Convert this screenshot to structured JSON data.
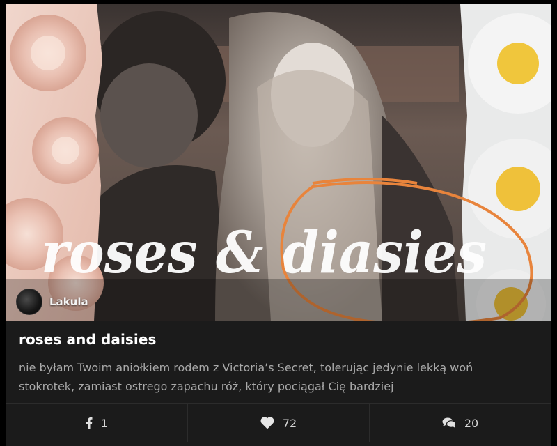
{
  "cover": {
    "overlay_text": "roses & diasies"
  },
  "author": {
    "name": "Lakula"
  },
  "story": {
    "title": "roses and daisies",
    "description": "nie byłam Twoim aniołkiem rodem z Victoria’s Secret, tolerując jedynie lekką woń stokrotek, zamiast ostrego zapachu róż, który pociągał Cię bardziej"
  },
  "stats": {
    "facebook_shares": "1",
    "likes": "72",
    "comments": "20"
  },
  "icons": {
    "facebook": "facebook-icon",
    "like": "heart-icon",
    "comment": "comments-icon"
  },
  "colors": {
    "annotation_circle": "#e8843c",
    "card_bg": "#1b1b1b"
  }
}
